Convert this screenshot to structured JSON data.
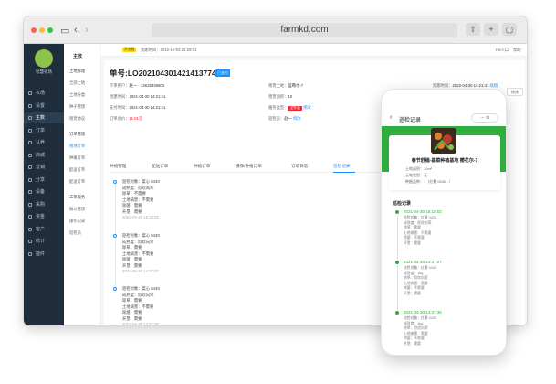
{
  "browser": {
    "url": "farmkd.com"
  },
  "sidebar": {
    "logo_text": "智慧农场",
    "items": [
      {
        "label": "农场",
        "active": false
      },
      {
        "label": "设置",
        "active": false
      },
      {
        "label": "主数",
        "active": true
      },
      {
        "label": "订单",
        "active": false
      },
      {
        "label": "认养",
        "active": false
      },
      {
        "label": "商城",
        "active": false
      },
      {
        "label": "营销",
        "active": false
      },
      {
        "label": "分享",
        "active": false
      },
      {
        "label": "设备",
        "active": false
      },
      {
        "label": "采购",
        "active": false
      },
      {
        "label": "资金",
        "active": false
      },
      {
        "label": "客户",
        "active": false
      },
      {
        "label": "统计",
        "active": false
      },
      {
        "label": "插件",
        "active": false
      }
    ]
  },
  "submenu": {
    "title": "主数",
    "groups": [
      {
        "title": "土地管理",
        "items": [
          "全部土地",
          "土地分类",
          "种子管理",
          "租赁协议"
        ]
      },
      {
        "title": "订单管理",
        "items": [
          "租地订单",
          "种植订单",
          "配送订单",
          "配送订单"
        ]
      },
      {
        "title": "工单服务",
        "items": [
          "报价管理",
          "操作记录",
          "巡检员"
        ]
      }
    ],
    "active_item": "租地订单"
  },
  "topbar": {
    "badge": "开发版",
    "expiry": "到期时间：2042-10-03 22:29:01",
    "right": "H5入口",
    "right2": "帮助"
  },
  "order": {
    "title": "单号:LO2021043014214137748",
    "status_tag": "已支付",
    "buyer_label": "下单用户：",
    "buyer": "赵一 · 13625335606",
    "land_label": "租赁土地：",
    "land": "蓝莓尔-7",
    "create_label": "创建时间：",
    "create_time": "2021-04-30 14:21:41",
    "area_label": "租赁面积：",
    "area": "10",
    "pay_label": "支付时间：",
    "pay_time": "2021-04-30 14:21:41",
    "service_label": "服务类型：",
    "service_tag": "全托管",
    "service_link": "修改",
    "amount_label": "订单总价：",
    "amount": "11.01元",
    "inspector_label": "巡检员：",
    "inspector": "赵一",
    "inspector_link": "修改",
    "expire_label": "到期时间：",
    "expire_time": "2022-04-30 14:21:41",
    "expire_link": "续租",
    "edit_btn": "修改"
  },
  "tabs": [
    "种植管理",
    "配送订单",
    "种植订单",
    "摄像/种植订单",
    "订单日志",
    "巡检记录"
  ],
  "active_tab": "巡检记录",
  "records": [
    {
      "lines": [
        "巡检对象：菜心 0430",
        "成熟度：欣欣向荣",
        "除草：不需要",
        "土地病害：不需要",
        "除菌：需要",
        "开垦：需要"
      ],
      "time": "2021-04-30 15:10:02"
    },
    {
      "lines": [
        "巡检对象：菜心 0430",
        "成熟度：欣欣向荣",
        "除草：需要",
        "土地病害：不需要",
        "除菌：需要",
        "开垦：需要"
      ],
      "time": "2021-04-30 14:37:07"
    },
    {
      "lines": [
        "巡检对象：菜心 0430",
        "成熟度：欣欣向荣",
        "除草：需要",
        "土地病害：不需要",
        "除菌：需要",
        "开垦：需要"
      ],
      "time": "2021-04-30 14:37:36"
    }
  ],
  "phone": {
    "title": "巡检记录",
    "caps": "··· ⊙",
    "name": "春节舒楹-基菜种植基地 樱花尔-7",
    "kv": [
      {
        "label": "土地面积：",
        "value": "10m²"
      },
      {
        "label": "土地类型：",
        "value": "无"
      },
      {
        "label": "种植品种：",
        "value": "1（红薯 0430...）"
      }
    ],
    "section_title": "巡检记录",
    "records": [
      {
        "date": "2021-04-30 15:10:02",
        "lines": [
          "巡检对象：红薯 0430",
          "成熟度：欣欣向荣",
          "除草：需要",
          "土地病害：不需要",
          "除菌：不需要",
          "开垦：需要"
        ]
      },
      {
        "date": "2021-04-30 14:37:07",
        "lines": [
          "巡检对象：红薯 0430",
          "成熟度：1kg",
          "除草：欣欣向荣",
          "土地病害：需要",
          "除菌：不需要",
          "开垦：需要"
        ]
      },
      {
        "date": "2021-04-30 14:37:36",
        "lines": [
          "巡检对象：红薯 0430",
          "成熟度：1kg",
          "除草：欣欣向荣",
          "土地病害：需要",
          "除菌：不需要",
          "开垦：需要"
        ]
      }
    ]
  },
  "colors": {
    "sidebar": "#1f2d3d",
    "accent": "#1890ff",
    "phone_green": "#2fae3e",
    "danger": "#f5222d"
  }
}
